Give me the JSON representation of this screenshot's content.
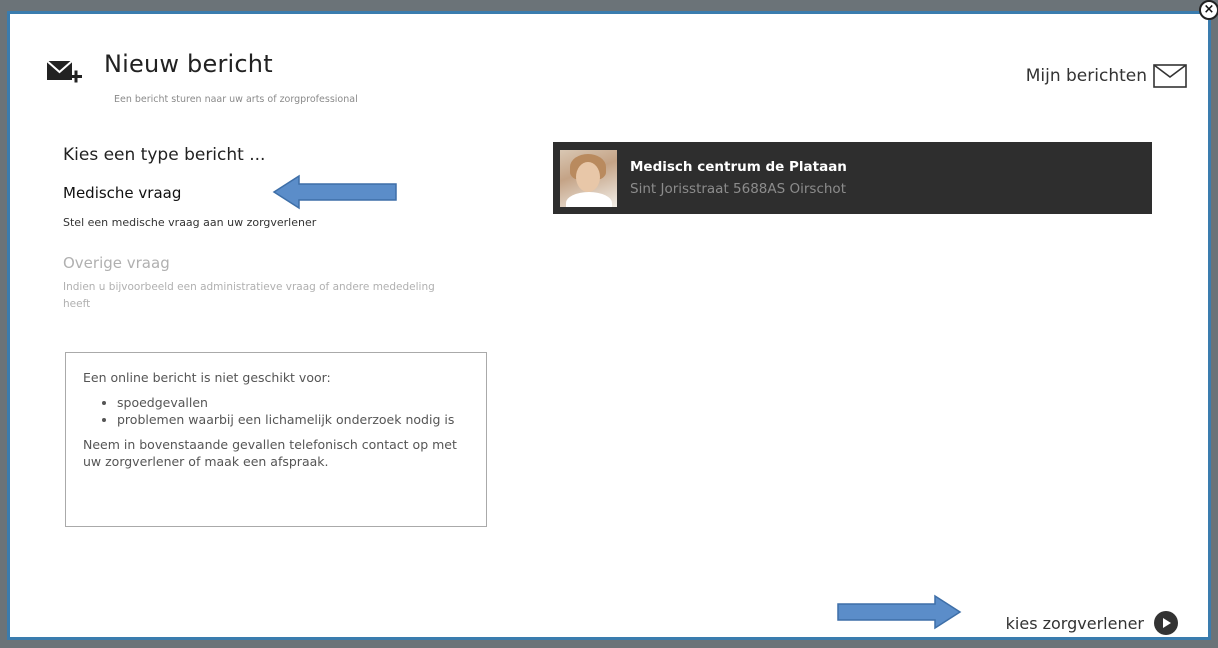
{
  "header": {
    "title": "Nieuw bericht",
    "subtitle": "Een bericht sturen naar uw arts of zorgprofessional",
    "my_messages": "Mijn berichten",
    "close": "×"
  },
  "form": {
    "choose_type": "Kies een type bericht ...",
    "options": [
      {
        "title": "Medische vraag",
        "description": "Stel een medische vraag aan uw zorgverlener"
      },
      {
        "title": "Overige vraag",
        "description": "Indien u bijvoorbeeld een administratieve vraag of andere mededeling heeft"
      }
    ]
  },
  "notice": {
    "intro": "Een online bericht is niet geschikt voor:",
    "items": [
      "spoedgevallen",
      "problemen waarbij een lichamelijk onderzoek nodig is"
    ],
    "outro": "Neem in bovenstaande gevallen telefonisch contact op met uw zorgverlener of maak een afspraak."
  },
  "provider": {
    "name": "Medisch centrum de Plataan",
    "address": "Sint Jorisstraat 5688AS Oirschot"
  },
  "footer": {
    "next_label": "kies zorgverlener"
  },
  "colors": {
    "border": "#3a7cae",
    "arrow": "#5b8dc9",
    "provider_bg": "#2e2e2e"
  },
  "icons": {
    "header": "envelope-plus-icon",
    "my_messages": "envelope-icon",
    "next": "play-circle-icon",
    "close": "close-icon"
  }
}
